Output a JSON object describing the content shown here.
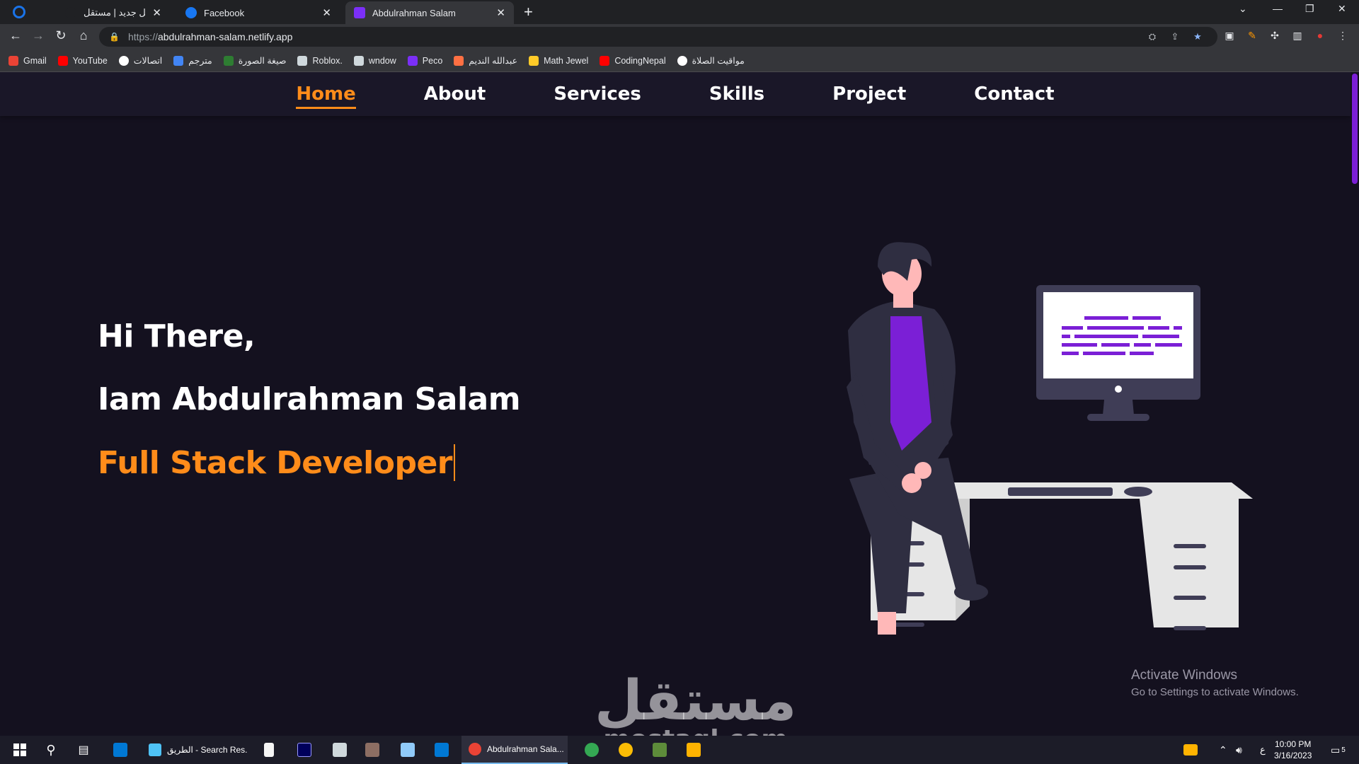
{
  "browser": {
    "tabs": [
      {
        "title": "إضافة عمل جديد | مستقل",
        "favicon_color": "#202124",
        "active": false
      },
      {
        "title": "Facebook",
        "favicon_color": "#1877f2",
        "active": false
      },
      {
        "title": "Abdulrahman Salam",
        "favicon_color": "#7b2ff7",
        "active": true
      }
    ],
    "url_scheme": "https://",
    "url_host": "abdulrahman-salam.netlify.app",
    "bookmarks": [
      {
        "label": "Gmail",
        "color": "#ea4335"
      },
      {
        "label": "YouTube",
        "color": "#ff0000"
      },
      {
        "label": "اتصالات",
        "color": "#ffffff"
      },
      {
        "label": "مترجم",
        "color": "#4285f4"
      },
      {
        "label": "صيغة الصورة",
        "color": "#2e7d32"
      },
      {
        "label": "Roblox.",
        "color": "#cfd8dc"
      },
      {
        "label": "wndow",
        "color": "#cfd8dc"
      },
      {
        "label": "Peco",
        "color": "#7b2ff7"
      },
      {
        "label": "عبدالله النديم",
        "color": "#ff7043"
      },
      {
        "label": "Math Jewel",
        "color": "#ffca28"
      },
      {
        "label": "CodingNepal",
        "color": "#ff0000"
      },
      {
        "label": "مواقيت الصلاة",
        "color": "#ffffff"
      }
    ]
  },
  "site": {
    "nav": [
      {
        "label": "Home",
        "active": true
      },
      {
        "label": "About",
        "active": false
      },
      {
        "label": "Services",
        "active": false
      },
      {
        "label": "Skills",
        "active": false
      },
      {
        "label": "Project",
        "active": false
      },
      {
        "label": "Contact",
        "active": false
      }
    ],
    "hero": {
      "greeting": "Hi There,",
      "name": "Iam Abdulrahman Salam",
      "role": "Full Stack Developer"
    },
    "accent_color": "#ff8c1a",
    "illustration_accent": "#7b1fd6"
  },
  "overlay": {
    "activate_title": "Activate Windows",
    "activate_sub": "Go to Settings to activate Windows.",
    "watermark_ar": "مستقل",
    "watermark_en": "mostaql.com"
  },
  "taskbar": {
    "apps": [
      {
        "label": "الطريق - Search Res...",
        "color": "#4fc3f7"
      },
      {
        "label": "Abdulrahman Sala...",
        "color": "#ea4335"
      }
    ],
    "lang": "ع",
    "time": "10:00 PM",
    "date": "3/16/2023",
    "notification_count": "5"
  }
}
